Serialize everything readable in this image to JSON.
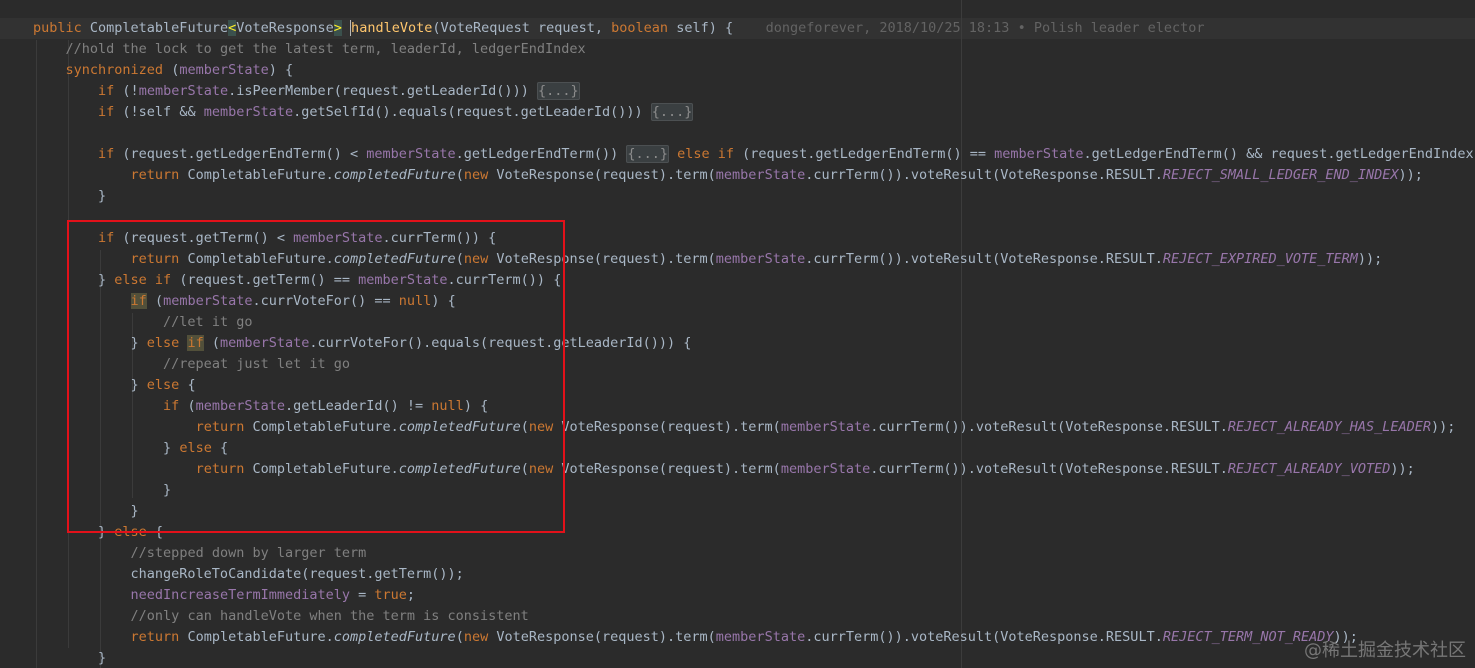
{
  "lines": [
    [
      {
        "t": "public ",
        "c": "kw"
      },
      {
        "t": "CompletableFuture"
      },
      {
        "t": "<",
        "c": "brace"
      },
      {
        "t": "VoteResponse"
      },
      {
        "t": ">",
        "c": "brace"
      },
      {
        "t": " "
      },
      {
        "t": "h",
        "c": "stat caret"
      },
      {
        "t": "andleVote",
        "c": "stat"
      },
      {
        "t": "(VoteRequest request, "
      },
      {
        "t": "boolean ",
        "c": "kw"
      },
      {
        "t": "self) {"
      },
      {
        "t": "    dongeforever, 2018/10/25 18:13 • Polish leader elector",
        "c": "blame"
      }
    ],
    [
      {
        "t": "    "
      },
      {
        "t": "//hold the lock to get the latest term, leaderId, ledgerEndIndex",
        "c": "cmt"
      }
    ],
    [
      {
        "t": "    "
      },
      {
        "t": "synchronized ",
        "c": "kw"
      },
      {
        "t": "("
      },
      {
        "t": "memberState",
        "c": "fld"
      },
      {
        "t": ") {"
      }
    ],
    [
      {
        "t": "        "
      },
      {
        "t": "if ",
        "c": "kw"
      },
      {
        "t": "(!"
      },
      {
        "t": "memberState",
        "c": "fld"
      },
      {
        "t": ".isPeerMember(request.getLeaderId())) "
      },
      {
        "t": "{...}",
        "c": "fold"
      }
    ],
    [
      {
        "t": "        "
      },
      {
        "t": "if ",
        "c": "kw"
      },
      {
        "t": "(!self && "
      },
      {
        "t": "memberState",
        "c": "fld"
      },
      {
        "t": ".getSelfId().equals(request.getLeaderId())) "
      },
      {
        "t": "{...}",
        "c": "fold"
      }
    ],
    [],
    [
      {
        "t": "        "
      },
      {
        "t": "if ",
        "c": "kw"
      },
      {
        "t": "(request.getLedgerEndTerm() < "
      },
      {
        "t": "memberState",
        "c": "fld"
      },
      {
        "t": ".getLedgerEndTerm()) "
      },
      {
        "t": "{...}",
        "c": "fold"
      },
      {
        "t": " "
      },
      {
        "t": "else if ",
        "c": "kw"
      },
      {
        "t": "(request.getLedgerEndTerm() == "
      },
      {
        "t": "memberState",
        "c": "fld"
      },
      {
        "t": ".getLedgerEndTerm() && request.getLedgerEndIndex() <"
      }
    ],
    [
      {
        "t": "            "
      },
      {
        "t": "return ",
        "c": "kw"
      },
      {
        "t": "CompletableFuture."
      },
      {
        "t": "completedFuture",
        "c": "it"
      },
      {
        "t": "("
      },
      {
        "t": "new ",
        "c": "kw"
      },
      {
        "t": "VoteResponse(request).term("
      },
      {
        "t": "memberState",
        "c": "fld"
      },
      {
        "t": ".currTerm()).voteResult(VoteResponse.RESULT."
      },
      {
        "t": "REJECT_SMALL_LEDGER_END_INDEX",
        "c": "fld it"
      },
      {
        "t": "));"
      }
    ],
    [
      {
        "t": "        }"
      }
    ],
    [],
    [
      {
        "t": "        "
      },
      {
        "t": "if ",
        "c": "kw"
      },
      {
        "t": "(request.getTerm() < "
      },
      {
        "t": "memberState",
        "c": "fld"
      },
      {
        "t": ".currTerm()) {"
      }
    ],
    [
      {
        "t": "            "
      },
      {
        "t": "return ",
        "c": "kw"
      },
      {
        "t": "CompletableFuture."
      },
      {
        "t": "completedFuture",
        "c": "it"
      },
      {
        "t": "("
      },
      {
        "t": "new ",
        "c": "kw"
      },
      {
        "t": "VoteResponse(request).term("
      },
      {
        "t": "memberState",
        "c": "fld"
      },
      {
        "t": ".currTerm()).voteResult(VoteResponse.RESULT."
      },
      {
        "t": "REJECT_EXPIRED_VOTE_TERM",
        "c": "fld it"
      },
      {
        "t": "));"
      }
    ],
    [
      {
        "t": "        } "
      },
      {
        "t": "else if ",
        "c": "kw"
      },
      {
        "t": "(request.getTerm() == "
      },
      {
        "t": "memberState",
        "c": "fld"
      },
      {
        "t": ".currTerm()) {"
      }
    ],
    [
      {
        "t": "            "
      },
      {
        "t": "if",
        "c": "kw hl"
      },
      {
        "t": " ("
      },
      {
        "t": "memberState",
        "c": "fld"
      },
      {
        "t": ".currVoteFor() == "
      },
      {
        "t": "null",
        "c": "kw"
      },
      {
        "t": ") {"
      }
    ],
    [
      {
        "t": "                "
      },
      {
        "t": "//let it go",
        "c": "cmt"
      }
    ],
    [
      {
        "t": "            } "
      },
      {
        "t": "else ",
        "c": "kw"
      },
      {
        "t": "if",
        "c": "kw hl"
      },
      {
        "t": " ("
      },
      {
        "t": "memberState",
        "c": "fld"
      },
      {
        "t": ".currVoteFor().equals(request.getLeaderId())) {"
      }
    ],
    [
      {
        "t": "                "
      },
      {
        "t": "//repeat just let it go",
        "c": "cmt"
      }
    ],
    [
      {
        "t": "            } "
      },
      {
        "t": "else ",
        "c": "kw"
      },
      {
        "t": "{"
      }
    ],
    [
      {
        "t": "                "
      },
      {
        "t": "if ",
        "c": "kw"
      },
      {
        "t": "("
      },
      {
        "t": "memberState",
        "c": "fld"
      },
      {
        "t": ".getLeaderId() != "
      },
      {
        "t": "null",
        "c": "kw"
      },
      {
        "t": ") {"
      }
    ],
    [
      {
        "t": "                    "
      },
      {
        "t": "return ",
        "c": "kw"
      },
      {
        "t": "CompletableFuture."
      },
      {
        "t": "completedFuture",
        "c": "it"
      },
      {
        "t": "("
      },
      {
        "t": "new ",
        "c": "kw"
      },
      {
        "t": "VoteResponse(request).term("
      },
      {
        "t": "memberState",
        "c": "fld"
      },
      {
        "t": ".currTerm()).voteResult(VoteResponse.RESULT."
      },
      {
        "t": "REJECT_ALREADY_HAS_LEADER",
        "c": "fld it"
      },
      {
        "t": "));"
      }
    ],
    [
      {
        "t": "                } "
      },
      {
        "t": "else ",
        "c": "kw"
      },
      {
        "t": "{"
      }
    ],
    [
      {
        "t": "                    "
      },
      {
        "t": "return ",
        "c": "kw"
      },
      {
        "t": "CompletableFuture."
      },
      {
        "t": "completedFuture",
        "c": "it"
      },
      {
        "t": "("
      },
      {
        "t": "new ",
        "c": "kw"
      },
      {
        "t": "VoteResponse(request).term("
      },
      {
        "t": "memberState",
        "c": "fld"
      },
      {
        "t": ".currTerm()).voteResult(VoteResponse.RESULT."
      },
      {
        "t": "REJECT_ALREADY_VOTED",
        "c": "fld it"
      },
      {
        "t": "));"
      }
    ],
    [
      {
        "t": "                }"
      }
    ],
    [
      {
        "t": "            }"
      }
    ],
    [
      {
        "t": "        } "
      },
      {
        "t": "else ",
        "c": "kw"
      },
      {
        "t": "{"
      }
    ],
    [
      {
        "t": "            "
      },
      {
        "t": "//stepped down by larger term",
        "c": "cmt"
      }
    ],
    [
      {
        "t": "            changeRoleToCandidate(request.getTerm());"
      }
    ],
    [
      {
        "t": "            "
      },
      {
        "t": "needIncreaseTermImmediately",
        "c": "fld"
      },
      {
        "t": " = "
      },
      {
        "t": "true",
        "c": "kw"
      },
      {
        "t": ";"
      }
    ],
    [
      {
        "t": "            "
      },
      {
        "t": "//only can handleVote when the term is consistent",
        "c": "cmt"
      }
    ],
    [
      {
        "t": "            "
      },
      {
        "t": "return ",
        "c": "kw"
      },
      {
        "t": "CompletableFuture."
      },
      {
        "t": "completedFuture",
        "c": "it"
      },
      {
        "t": "("
      },
      {
        "t": "new ",
        "c": "kw"
      },
      {
        "t": "VoteResponse(request).term("
      },
      {
        "t": "memberState",
        "c": "fld"
      },
      {
        "t": ".currTerm()).voteResult(VoteResponse.RESULT."
      },
      {
        "t": "REJECT_TERM_NOT_READY",
        "c": "fld it"
      },
      {
        "t": "));"
      }
    ],
    [
      {
        "t": "        }"
      }
    ]
  ],
  "watermark": "@稀土掘金技术社区",
  "colors": {
    "background": "#2b2b2b",
    "text": "#a9b7c6",
    "keyword": "#cc7832",
    "field": "#9876aa",
    "comment": "#808080",
    "method_declaration": "#ffc66d",
    "annotation_box": "#e3111a"
  }
}
